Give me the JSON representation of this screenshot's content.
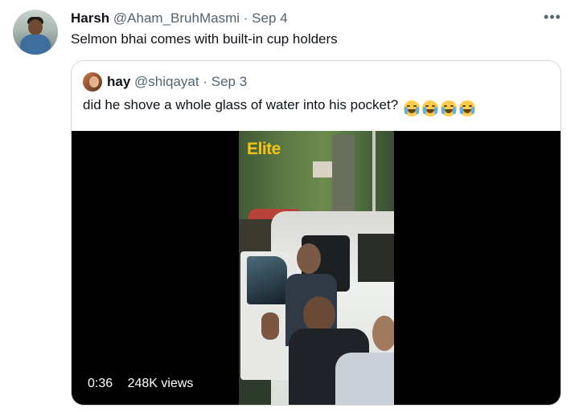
{
  "tweet": {
    "author_name": "Harsh",
    "author_handle": "@Aham_BruhMasmi",
    "separator": "·",
    "date": "Sep 4",
    "text": "Selmon bhai comes with built-in cup holders",
    "more_label": "•••"
  },
  "quoted_tweet": {
    "author_name": "hay",
    "author_handle": "@shiqayat",
    "separator": "·",
    "date": "Sep 3",
    "text": "did he shove a whole glass of water into his pocket?",
    "emojis": [
      "loudly-crying-face",
      "loudly-crying-face",
      "face-with-tears-of-joy",
      "face-with-tears-of-joy"
    ]
  },
  "video": {
    "watermark": "Elite",
    "duration": "0:36",
    "views": "248K views"
  },
  "colors": {
    "text_primary": "#0f1419",
    "text_secondary": "#536471",
    "border": "#cfd9de",
    "watermark": "#f2c418",
    "emoji_yellow": "#ffcc4d"
  }
}
